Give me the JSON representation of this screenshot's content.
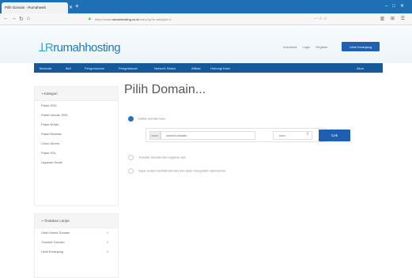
{
  "browser": {
    "tab_title": "Pilih Domain - Rumahweb",
    "url_prefix": "https://www.",
    "url_domain": "rumahhosting.co.id",
    "url_path": "/cart.php?a=add&pid=1",
    "url_actions": "··· ☆ ☆"
  },
  "header": {
    "logo_brand": "rumahhosting",
    "top_links": [
      "Indonesia",
      "Login",
      "Register"
    ],
    "cart_button": "Lihat Keranjang"
  },
  "nav": {
    "items": [
      "Beranda",
      "Beli",
      "Pengumuman",
      "Pengetahuan",
      "Network Status",
      "Afiliasi",
      "Hubungi Kami"
    ],
    "account": "Akun"
  },
  "sidebar": {
    "categories_title": "Kategori",
    "categories": [
      "Paket SSD",
      "Paket Ukuran SSD",
      "Paket NVMe",
      "Paket Reseller",
      "Cloud Server",
      "Paket SSL",
      "Layanan Email"
    ],
    "actions_title": "Tindakan Lanjut",
    "actions": [
      {
        "label": "Ubah Nama Domain",
        "count": "0"
      },
      {
        "label": "Transfer Domain",
        "count": "0"
      },
      {
        "label": "Lihat Keranjang",
        "count": "0"
      }
    ]
  },
  "main": {
    "title": "Pilih Domain...",
    "option_register": "Daftar domain baru",
    "domain_prefix": "www.",
    "domain_value": "contoh-domain",
    "tld_value": ".com",
    "check_button": "Cek",
    "option_transfer": "Transfer domain dari registrar lain",
    "option_own": "Saya sudah memiliki domain dan akan mengubah nameserver"
  }
}
